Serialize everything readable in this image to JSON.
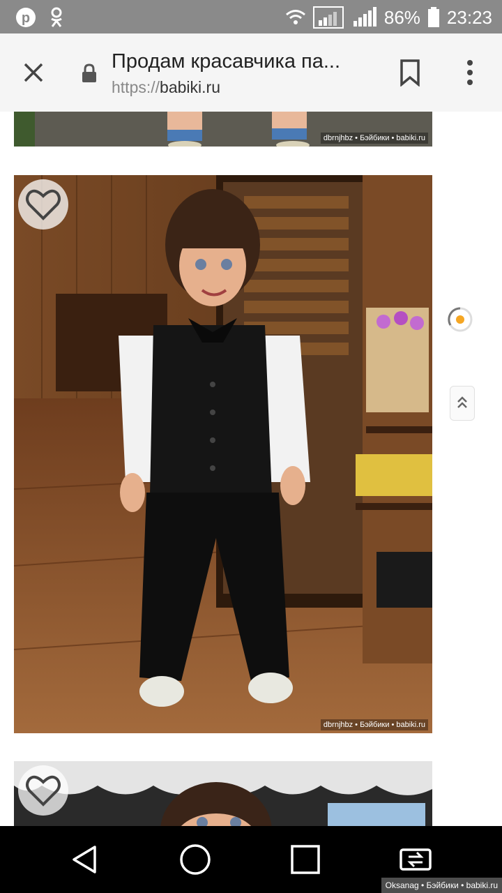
{
  "status_bar": {
    "battery_percent": "86%",
    "time": "23:23",
    "left_icons": [
      "pinterest-icon",
      "odnoklassniki-icon"
    ],
    "right_icons": [
      "wifi-icon",
      "signal-1-icon",
      "signal-2-icon",
      "battery-icon"
    ]
  },
  "toolbar": {
    "page_title": "Продам красавчика па...",
    "url_scheme": "https://",
    "url_host": "babiki.ru"
  },
  "images": [
    {
      "watermark": "dbrnjhbz • Бэйбики • babiki.ru"
    },
    {
      "watermark": "dbrnjhbz • Бэйбики • babiki.ru"
    },
    {
      "watermark": ""
    }
  ],
  "bottom_watermark": "Oksanag • Бэйбики • babiki.ru",
  "colors": {
    "status_bar": "#8a8a8a",
    "toolbar_bg": "#f5f5f5",
    "nav_bar": "#000000",
    "spinner_accent": "#f5a623"
  }
}
